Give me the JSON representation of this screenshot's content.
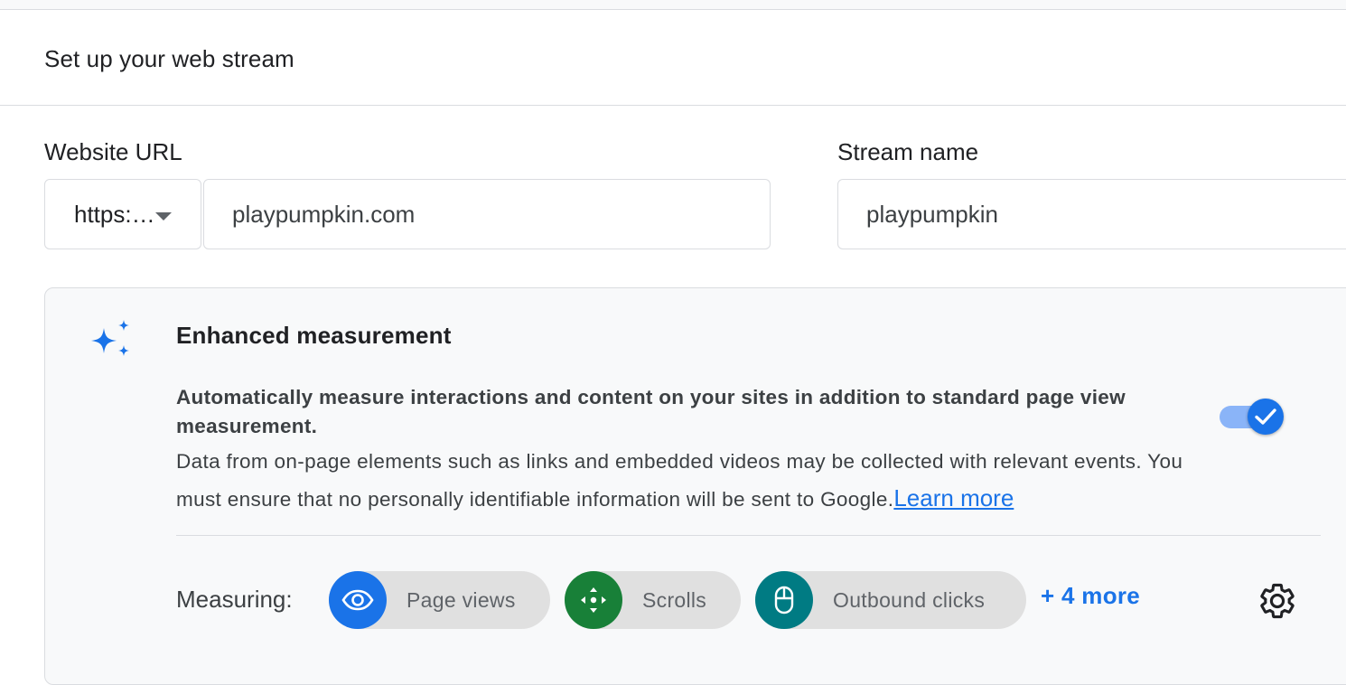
{
  "header": {
    "title": "Set up your web stream"
  },
  "form": {
    "website_url_label": "Website URL",
    "protocol_value": "https:…",
    "url_value": "playpumpkin.com",
    "stream_name_label": "Stream name",
    "stream_name_value": "playpumpkin"
  },
  "enhanced_measurement": {
    "title": "Enhanced measurement",
    "description_bold": "Automatically measure interactions and content on your sites in addition to standard page view measurement.",
    "description": "Data from on-page elements such as links and embedded videos may be collected with relevant events. You must ensure that no personally identifiable information will be sent to Google.",
    "learn_more": "Learn more",
    "enabled": true,
    "measuring_label": "Measuring:",
    "chips": [
      {
        "label": "Page views",
        "icon": "eye-icon",
        "color": "#1a73e8"
      },
      {
        "label": "Scrolls",
        "icon": "scroll-arrows-icon",
        "color": "#188038"
      },
      {
        "label": "Outbound clicks",
        "icon": "mouse-icon",
        "color": "#007b83"
      }
    ],
    "more_link": "+ 4 more"
  },
  "colors": {
    "accent": "#1a73e8",
    "card_background": "#f8f9fa",
    "border": "#dadce0"
  }
}
